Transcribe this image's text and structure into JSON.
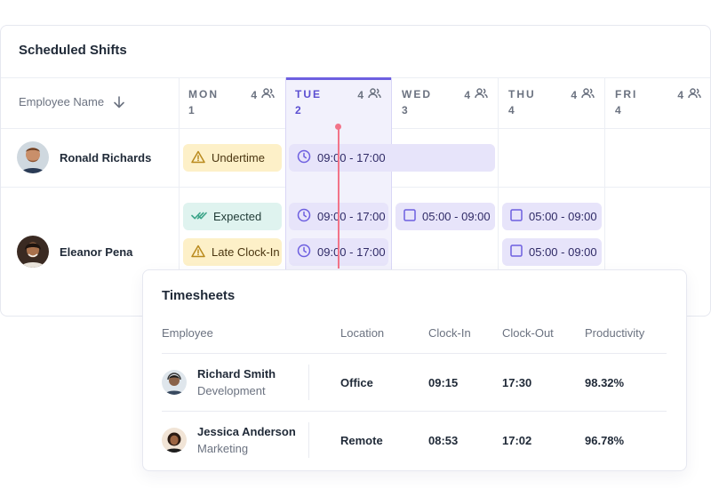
{
  "shifts": {
    "title": "Scheduled Shifts",
    "employee_header": "Employee Name",
    "days": [
      {
        "name": "MON",
        "num": "1",
        "count": "4"
      },
      {
        "name": "TUE",
        "num": "2",
        "count": "4"
      },
      {
        "name": "WED",
        "num": "3",
        "count": "4"
      },
      {
        "name": "THU",
        "num": "4",
        "count": "4"
      },
      {
        "name": "FRI",
        "num": "4",
        "count": "4"
      }
    ],
    "employees": [
      {
        "name": "Ronald Richards",
        "pills": {
          "status": "Undertime",
          "tue_wed": "09:00 - 17:00"
        }
      },
      {
        "name": "Eleanor Pena",
        "pills": {
          "status1": "Expected",
          "status2": "Late Clock-In",
          "tue1": "09:00 - 17:00",
          "tue2": "09:00 - 17:00",
          "wed1": "05:00 - 09:00",
          "thu1": "05:00 - 09:00",
          "thu2": "05:00 - 09:00"
        }
      }
    ],
    "colors": {
      "accent": "#6d5fe0",
      "now_line": "#f27489"
    }
  },
  "timesheets": {
    "title": "Timesheets",
    "columns": [
      "Employee",
      "Location",
      "Clock-In",
      "Clock-Out",
      "Productivity"
    ],
    "rows": [
      {
        "name": "Richard Smith",
        "dept": "Development",
        "location": "Office",
        "clock_in": "09:15",
        "clock_out": "17:30",
        "productivity": "98.32%"
      },
      {
        "name": "Jessica Anderson",
        "dept": "Marketing",
        "location": "Remote",
        "clock_in": "08:53",
        "clock_out": "17:02",
        "productivity": "96.78%"
      }
    ]
  }
}
